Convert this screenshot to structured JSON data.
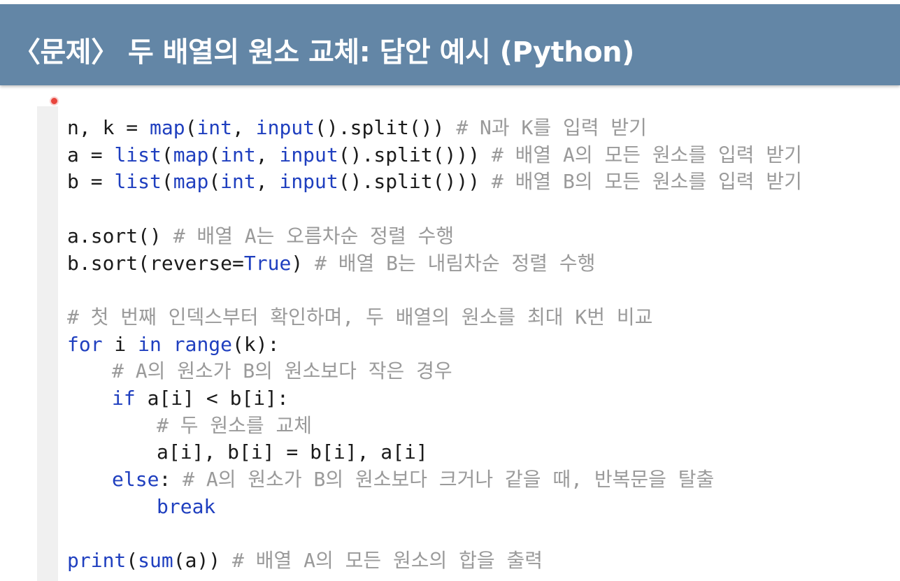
{
  "title": "〈문제〉 두 배열의 원소 교체: 답안 예시 (Python)",
  "colors": {
    "title_bar": "#6386a6",
    "keyword": "#1f3fbf",
    "comment": "#9a9a9a",
    "marker": "#e8453c"
  },
  "code": {
    "lines": [
      {
        "indent": 0,
        "tokens": [
          {
            "t": "n, k = ",
            "c": "p"
          },
          {
            "t": "map",
            "c": "kw"
          },
          {
            "t": "(",
            "c": "p"
          },
          {
            "t": "int",
            "c": "kw"
          },
          {
            "t": ", ",
            "c": "p"
          },
          {
            "t": "input",
            "c": "kw"
          },
          {
            "t": "().split()) ",
            "c": "p"
          },
          {
            "t": "# N과 K를 입력 받기",
            "c": "cm"
          }
        ]
      },
      {
        "indent": 0,
        "tokens": [
          {
            "t": "a = ",
            "c": "p"
          },
          {
            "t": "list",
            "c": "kw"
          },
          {
            "t": "(",
            "c": "p"
          },
          {
            "t": "map",
            "c": "kw"
          },
          {
            "t": "(",
            "c": "p"
          },
          {
            "t": "int",
            "c": "kw"
          },
          {
            "t": ", ",
            "c": "p"
          },
          {
            "t": "input",
            "c": "kw"
          },
          {
            "t": "().split())) ",
            "c": "p"
          },
          {
            "t": "# 배열 A의 모든 원소를 입력 받기",
            "c": "cm"
          }
        ]
      },
      {
        "indent": 0,
        "tokens": [
          {
            "t": "b = ",
            "c": "p"
          },
          {
            "t": "list",
            "c": "kw"
          },
          {
            "t": "(",
            "c": "p"
          },
          {
            "t": "map",
            "c": "kw"
          },
          {
            "t": "(",
            "c": "p"
          },
          {
            "t": "int",
            "c": "kw"
          },
          {
            "t": ", ",
            "c": "p"
          },
          {
            "t": "input",
            "c": "kw"
          },
          {
            "t": "().split())) ",
            "c": "p"
          },
          {
            "t": "# 배열 B의 모든 원소를 입력 받기",
            "c": "cm"
          }
        ]
      },
      {
        "indent": 0,
        "tokens": []
      },
      {
        "indent": 0,
        "tokens": [
          {
            "t": "a.sort() ",
            "c": "p"
          },
          {
            "t": "# 배열 A는 오름차순 정렬 수행",
            "c": "cm"
          }
        ]
      },
      {
        "indent": 0,
        "tokens": [
          {
            "t": "b.sort(reverse=",
            "c": "p"
          },
          {
            "t": "True",
            "c": "kw"
          },
          {
            "t": ") ",
            "c": "p"
          },
          {
            "t": "# 배열 B는 내림차순 정렬 수행",
            "c": "cm"
          }
        ]
      },
      {
        "indent": 0,
        "tokens": []
      },
      {
        "indent": 0,
        "tokens": [
          {
            "t": "# 첫 번째 인덱스부터 확인하며, 두 배열의 원소를 최대 K번 비교",
            "c": "cm"
          }
        ]
      },
      {
        "indent": 0,
        "tokens": [
          {
            "t": "for",
            "c": "kw"
          },
          {
            "t": " i ",
            "c": "p"
          },
          {
            "t": "in",
            "c": "kw"
          },
          {
            "t": " ",
            "c": "p"
          },
          {
            "t": "range",
            "c": "kw"
          },
          {
            "t": "(k):",
            "c": "p"
          }
        ]
      },
      {
        "indent": 1,
        "tokens": [
          {
            "t": "# A의 원소가 B의 원소보다 작은 경우",
            "c": "cm"
          }
        ]
      },
      {
        "indent": 1,
        "tokens": [
          {
            "t": "if",
            "c": "kw"
          },
          {
            "t": " a[i] < b[i]:",
            "c": "p"
          }
        ]
      },
      {
        "indent": 2,
        "tokens": [
          {
            "t": "# 두 원소를 교체",
            "c": "cm"
          }
        ]
      },
      {
        "indent": 2,
        "tokens": [
          {
            "t": "a[i], b[i] = b[i], a[i]",
            "c": "p"
          }
        ]
      },
      {
        "indent": 1,
        "tokens": [
          {
            "t": "else",
            "c": "kw"
          },
          {
            "t": ": ",
            "c": "p"
          },
          {
            "t": "# A의 원소가 B의 원소보다 크거나 같을 때, 반복문을 탈출",
            "c": "cm"
          }
        ]
      },
      {
        "indent": 2,
        "tokens": [
          {
            "t": "break",
            "c": "kw"
          }
        ]
      },
      {
        "indent": 0,
        "tokens": []
      },
      {
        "indent": 0,
        "tokens": [
          {
            "t": "print",
            "c": "kw"
          },
          {
            "t": "(",
            "c": "p"
          },
          {
            "t": "sum",
            "c": "kw"
          },
          {
            "t": "(a)) ",
            "c": "p"
          },
          {
            "t": "# 배열 A의 모든 원소의 합을 출력",
            "c": "cm"
          }
        ]
      }
    ]
  }
}
